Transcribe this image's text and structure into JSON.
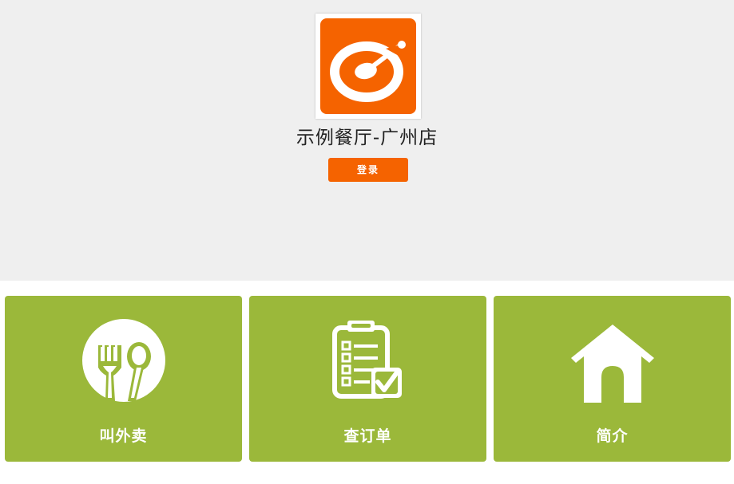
{
  "colors": {
    "header_bg": "#efefef",
    "brand_orange": "#f56300",
    "tile_green": "#9bb83a",
    "white": "#ffffff"
  },
  "header": {
    "logo_icon": "spoon-bowl-logo-icon",
    "store_name": "示例餐厅-广州店",
    "login_label": "登录"
  },
  "tiles": [
    {
      "label": "叫外卖",
      "icon": "fork-spoon-plate-icon"
    },
    {
      "label": "查订单",
      "icon": "clipboard-checklist-icon"
    },
    {
      "label": "简介",
      "icon": "house-icon"
    }
  ]
}
